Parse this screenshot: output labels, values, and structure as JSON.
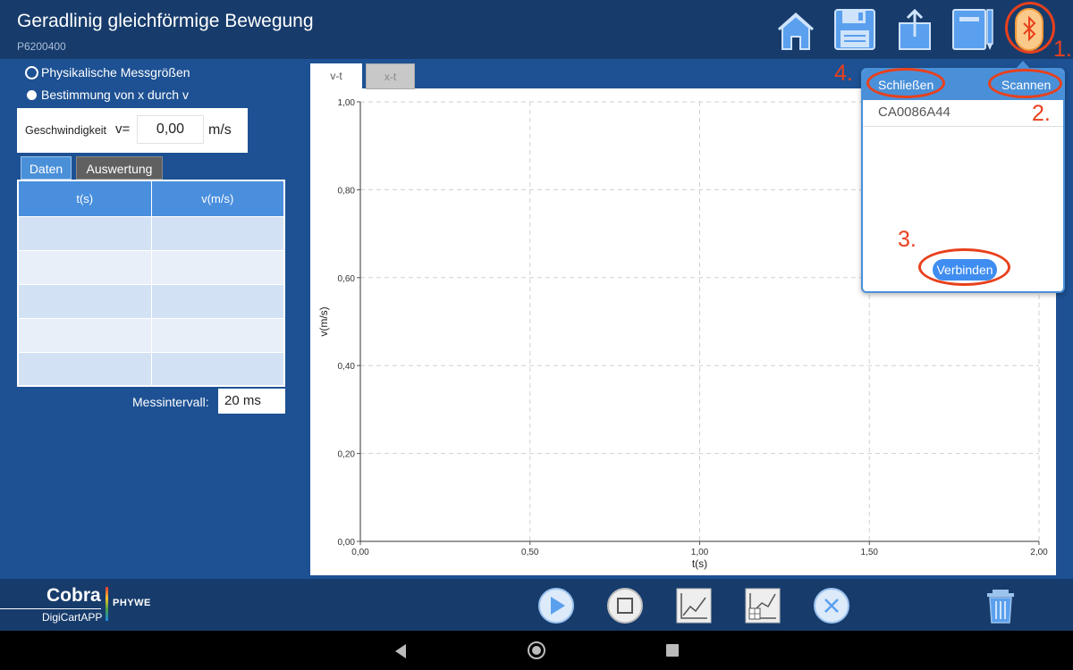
{
  "header": {
    "title": "Geradlinig gleichförmige Bewegung",
    "code": "P6200400",
    "icons": [
      "home-icon",
      "save-icon",
      "share-icon",
      "notebook-icon",
      "bluetooth-icon"
    ]
  },
  "left_panel": {
    "radio_options": [
      "Physikalische Messgrößen",
      "Bestimmung von x durch v"
    ],
    "selected_radio": 0,
    "speed": {
      "label": "Geschwindigkeit",
      "symbol": "v=",
      "value": "0,00",
      "unit": "m/s"
    },
    "tabs": [
      "Daten",
      "Auswertung"
    ],
    "active_tab": 0,
    "table": {
      "headers": [
        "t(s)",
        "v(m/s)"
      ],
      "rows": 5
    },
    "interval": {
      "label": "Messintervall:",
      "value": "20 ms"
    }
  },
  "chart": {
    "tabs": [
      "v-t",
      "x-t"
    ],
    "active_tab": 0
  },
  "chart_data": {
    "type": "line",
    "xlabel": "t(s)",
    "ylabel": "v(m/s)",
    "xlim": [
      0,
      2
    ],
    "ylim": [
      0,
      1
    ],
    "x_ticks": [
      "0,00",
      "0,50",
      "1,00",
      "1,50",
      "2,00"
    ],
    "y_ticks": [
      "0,00",
      "0,20",
      "0,40",
      "0,60",
      "0,80",
      "1,00"
    ],
    "grid": true,
    "series": []
  },
  "popup": {
    "close_label": "Schließen",
    "scan_label": "Scannen",
    "device": "CA0086A44",
    "connect_label": "Verbinden"
  },
  "annotations": [
    "1.",
    "2.",
    "3.",
    "4."
  ],
  "footer": {
    "logo_main": "Cobra",
    "logo_brand": "PHYWE",
    "logo_sub": "DigiCartAPP",
    "icons": [
      "play-icon",
      "stop-icon",
      "graph-icon",
      "analysis-icon",
      "clear-icon",
      "trash-icon"
    ]
  },
  "colors": {
    "background": "#1d5193",
    "header": "#173c6c",
    "accent": "#4a90d9",
    "annotation": "#e8401c"
  }
}
